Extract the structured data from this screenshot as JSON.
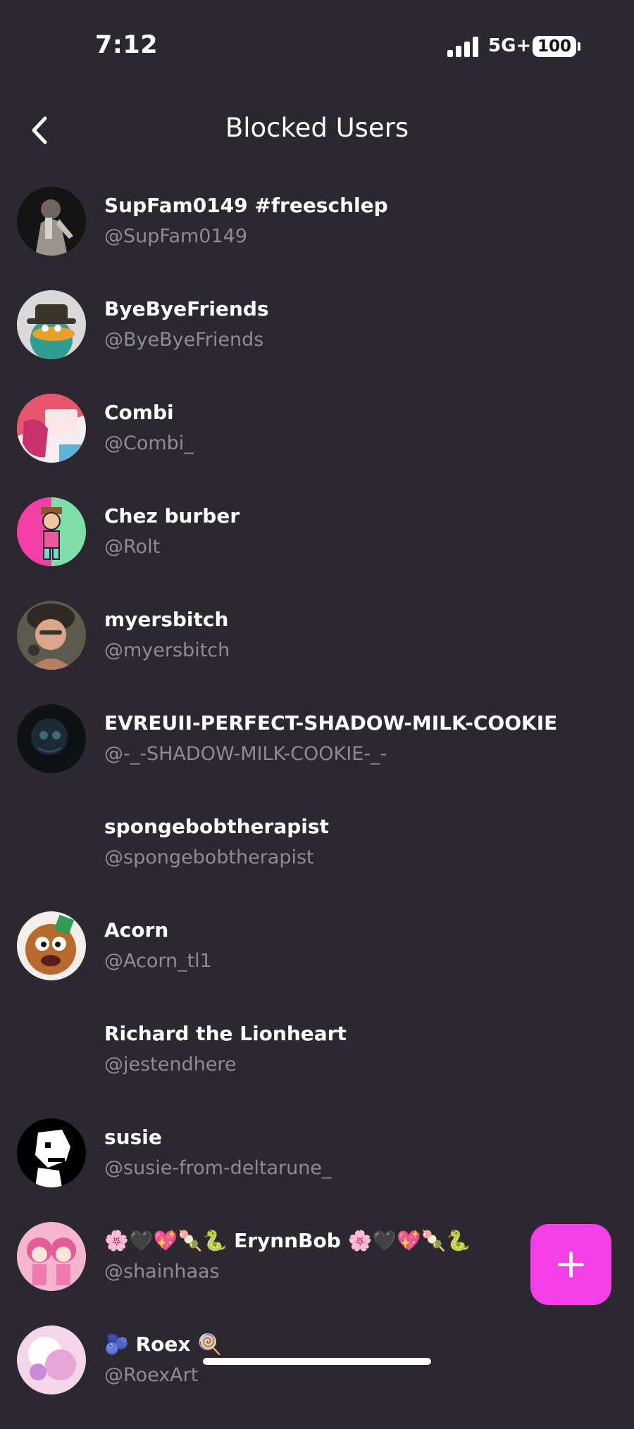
{
  "status_bar": {
    "time": "7:12",
    "network": "5G+",
    "battery": "100"
  },
  "header": {
    "title": "Blocked Users",
    "back_icon": "chevron-left-icon"
  },
  "users": [
    {
      "display_name": "SupFam0149 #freeschlep",
      "username": "@SupFam0149",
      "avatar_icon": "photo-avatar"
    },
    {
      "display_name": "ByeByeFriends",
      "username": "@ByeByeFriends",
      "avatar_icon": "platypus-avatar"
    },
    {
      "display_name": "Combi",
      "username": "@Combi_",
      "avatar_icon": "card-avatar"
    },
    {
      "display_name": "Chez burber",
      "username": "@Rolt",
      "avatar_icon": "cartoon-avatar"
    },
    {
      "display_name": "myersbitch",
      "username": "@myersbitch",
      "avatar_icon": "selfie-avatar"
    },
    {
      "display_name": "EVREUII-PERFECT-SHADOW-MILK-COOKIE",
      "username": "@-_-SHADOW-MILK-COOKIE-_-",
      "avatar_icon": "dark-avatar"
    },
    {
      "display_name": "spongebobtherapist",
      "username": "@spongebobtherapist",
      "avatar_icon": ""
    },
    {
      "display_name": "Acorn",
      "username": "@Acorn_tl1",
      "avatar_icon": "acorn-avatar"
    },
    {
      "display_name": "Richard the Lionheart",
      "username": "@jestendhere",
      "avatar_icon": ""
    },
    {
      "display_name": "susie",
      "username": "@susie-from-deltarune_",
      "avatar_icon": "pixel-avatar"
    },
    {
      "display_name": "🌸🖤💖🍡🐍 ErynnBob 🌸🖤💖🍡🐍",
      "username": "@shainhaas",
      "avatar_icon": "anime-avatar"
    },
    {
      "display_name": "🫐 Roex 🍭",
      "username": "@RoexArt",
      "avatar_icon": "pastel-avatar"
    }
  ],
  "fab": {
    "icon": "plus-icon",
    "color": "#f43ee8"
  },
  "colors": {
    "background": "#2b2830",
    "secondary_text": "#8f8b95",
    "accent": "#f43ee8"
  }
}
